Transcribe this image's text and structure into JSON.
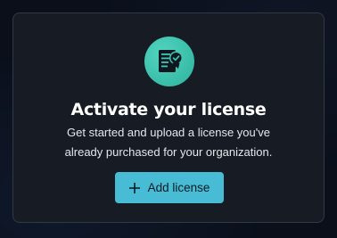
{
  "card": {
    "icon": "license-document-check-icon",
    "title": "Activate your license",
    "description_line1": "Get started and upload a license you've",
    "description_line2": "already purchased for your organization.",
    "add_button": {
      "icon": "plus-icon",
      "label": "Add license"
    }
  },
  "colors": {
    "page_background": "#0a0f1a",
    "card_background": "#171c24",
    "card_border": "#323944",
    "icon_circle": "#3fc7b3",
    "icon_document": "#0f1821",
    "button_background": "#48bcd4",
    "button_text": "#0d1a22",
    "title_text": "#ffffff",
    "description_text": "#e4e7eb"
  }
}
